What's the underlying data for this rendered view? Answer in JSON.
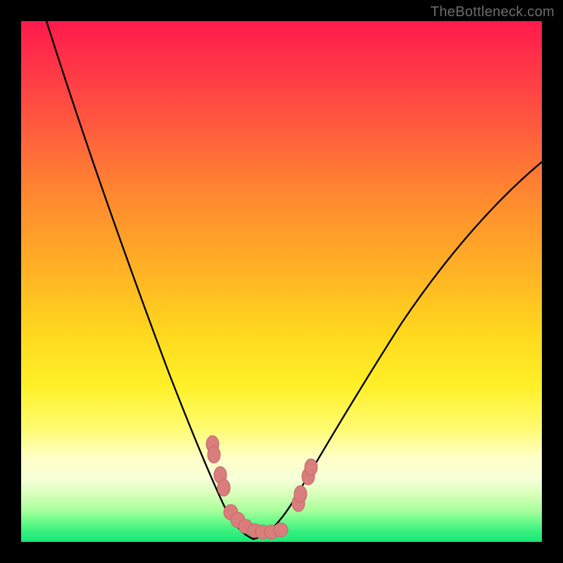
{
  "watermark": {
    "text": "TheBottleneck.com"
  },
  "colors": {
    "frame": "#000000",
    "curve_stroke": "#000000",
    "marker_fill": "#d97d7d",
    "marker_stroke": "#c46868",
    "gradient_stops": [
      "#ff1a4d",
      "#ff3348",
      "#ff5a3e",
      "#ff8a2f",
      "#ffb224",
      "#ffd81e",
      "#fff028",
      "#fffb6e",
      "#ffffc8",
      "#f5ffd8",
      "#d6ffb8",
      "#a8ff9c",
      "#6cfb8b",
      "#37f07f",
      "#18e877"
    ]
  },
  "chart_data": {
    "type": "line",
    "title": "",
    "xlabel": "",
    "ylabel": "",
    "xlim": [
      0,
      100
    ],
    "ylim": [
      0,
      100
    ],
    "grid": false,
    "series": [
      {
        "name": "left-branch",
        "x": [
          5,
          10,
          15,
          20,
          25,
          28,
          30,
          32,
          34,
          35,
          36,
          37,
          38,
          39,
          40,
          41,
          42,
          43,
          44,
          45
        ],
        "y": [
          100,
          80,
          63,
          48,
          34,
          26,
          21,
          16,
          12,
          10,
          8,
          6.5,
          5,
          4,
          3,
          2.2,
          1.6,
          1.1,
          0.7,
          0.4
        ]
      },
      {
        "name": "right-branch",
        "x": [
          45,
          46,
          47,
          48,
          49,
          50,
          52,
          55,
          60,
          65,
          70,
          75,
          80,
          85,
          90,
          95,
          100
        ],
        "y": [
          0.4,
          0.7,
          1.2,
          1.8,
          2.5,
          3.3,
          5.2,
          8.3,
          14,
          20,
          26,
          32,
          38,
          44,
          50,
          56,
          62
        ]
      }
    ],
    "markers": [
      {
        "name": "left-cluster-1",
        "x": 37.0,
        "y": 18.5
      },
      {
        "name": "left-cluster-2",
        "x": 37.2,
        "y": 16.5
      },
      {
        "name": "left-cluster-3",
        "x": 38.5,
        "y": 12.5
      },
      {
        "name": "left-cluster-4",
        "x": 39.2,
        "y": 10.0
      },
      {
        "name": "bottom-1",
        "x": 40.5,
        "y": 5.3
      },
      {
        "name": "bottom-2",
        "x": 41.8,
        "y": 3.8
      },
      {
        "name": "bottom-3",
        "x": 43.3,
        "y": 2.5
      },
      {
        "name": "bottom-4",
        "x": 45.0,
        "y": 1.7
      },
      {
        "name": "bottom-5",
        "x": 46.5,
        "y": 1.4
      },
      {
        "name": "bottom-6",
        "x": 48.2,
        "y": 1.4
      },
      {
        "name": "bottom-7",
        "x": 50.0,
        "y": 1.8
      },
      {
        "name": "right-cluster-1",
        "x": 53.4,
        "y": 7.1
      },
      {
        "name": "right-cluster-2",
        "x": 53.8,
        "y": 8.8
      },
      {
        "name": "right-cluster-3",
        "x": 55.3,
        "y": 12.2
      },
      {
        "name": "right-cluster-4",
        "x": 55.8,
        "y": 13.9
      }
    ]
  }
}
